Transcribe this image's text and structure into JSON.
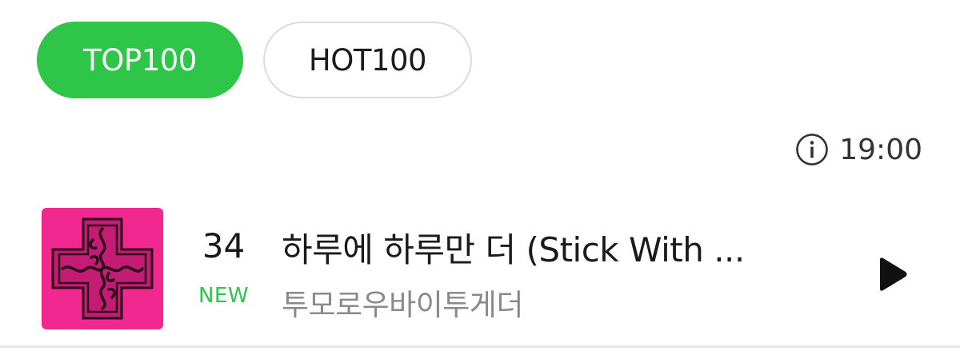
{
  "tabs": {
    "top100_label": "TOP100",
    "hot100_label": "HOT100",
    "active": "TOP100"
  },
  "chart_info": {
    "update_time": "19:00",
    "icon": "info-icon"
  },
  "chart_entry": {
    "rank": "34",
    "rank_change": "NEW",
    "title": "하루에 하루만 더 (Stick With ...",
    "artist": "투모로우바이투게더",
    "cover_icon": "album-cover",
    "play_icon": "play-icon"
  },
  "colors": {
    "accent": "#2ec548",
    "cover_pink": "#f0288f",
    "divider": "#e6e6e6"
  }
}
